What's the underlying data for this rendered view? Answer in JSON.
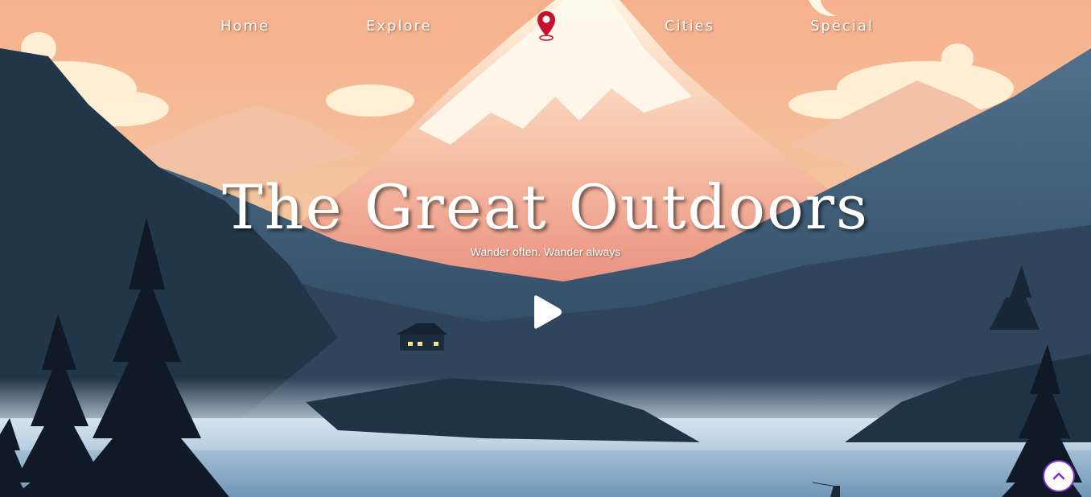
{
  "nav": {
    "home": "Home",
    "explore": "Explore",
    "cities": "Cities",
    "special": "Special",
    "logo_icon": "map-pin-icon"
  },
  "hero": {
    "title": "The Great Outdoors",
    "subtitle": "Wander often. Wander always",
    "play_icon": "play-icon"
  },
  "scroll_top": {
    "icon": "chevron-up-icon"
  },
  "colors": {
    "accent": "#7c2fd1",
    "pin": "#c8102e",
    "sky_top": "#f6b38c",
    "sky_bottom": "#f4cfa3",
    "mountain_snow": "#fde9d6",
    "lake": "#8eb3d0"
  }
}
